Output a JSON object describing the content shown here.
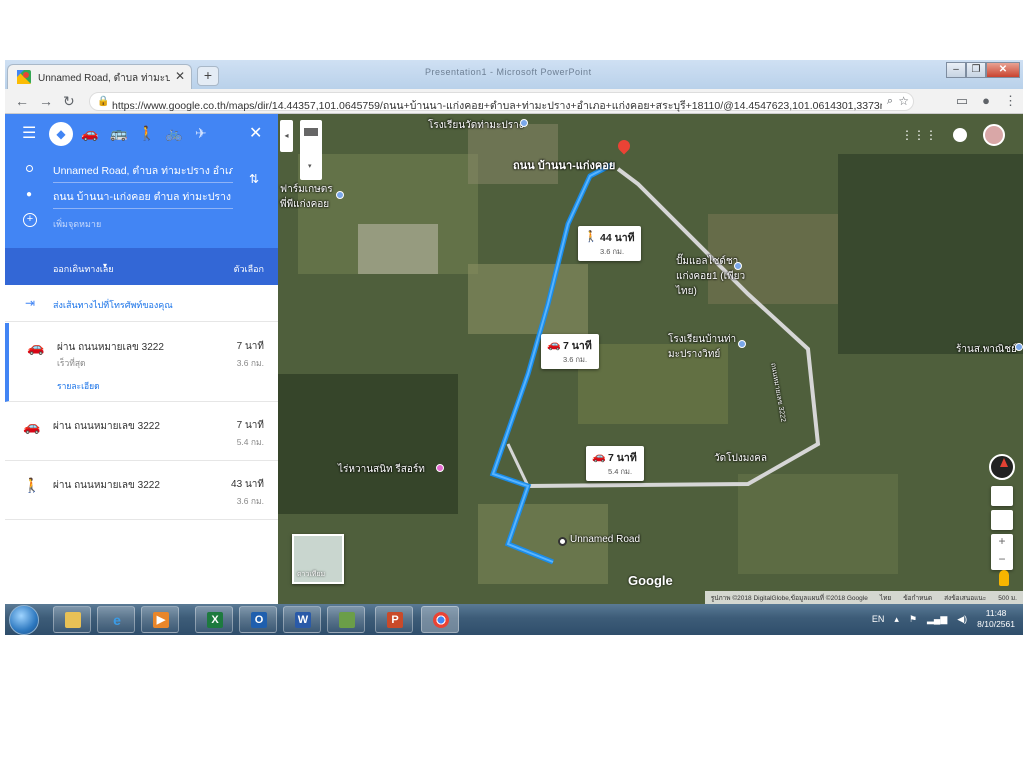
{
  "browser": {
    "tab_title": "Unnamed Road, ตำบล ท่ามะปราง อำ",
    "tab_close": "✕",
    "new_tab": "+",
    "window_title": "Presentation1 - Microsoft PowerPoint",
    "url": "https://www.google.co.th/maps/dir/14.44357,101.0645759/ถนน+บ้านนา-แก่งคอย+ตำบล+ท่ามะปราง+อำเภอ+แก่งคอย+สระบุรี+18110/@14.4547623,101.0614301,3373m/da..."
  },
  "directions": {
    "origin": "Unnamed Road, ตำบล ท่ามะปราง อำเภอ",
    "destination": "ถนน บ้านนา-แก่งคอย ตำบล ท่ามะปราง อำ",
    "add_destination": "เพิ่มจุดหมาย",
    "depart_label": "ออกเดินทางเลย",
    "options_label": "ตัวเลือก",
    "send_to_phone": "ส่งเส้นทางไปที่โทรศัพท์ของคุณ",
    "routes": [
      {
        "mode": "car",
        "via": "ผ่าน ถนนหมายเลข 3222",
        "time": "7 นาที",
        "distance": "3.6 กม.",
        "sub": "เร็วที่สุด",
        "details": "รายละเอียด"
      },
      {
        "mode": "car",
        "via": "ผ่าน ถนนหมายเลข 3222",
        "time": "7 นาที",
        "distance": "5.4 กม."
      },
      {
        "mode": "walk",
        "via": "ผ่าน ถนนหมายเลข 3222",
        "time": "43 นาที",
        "distance": "3.6 กม."
      }
    ]
  },
  "map": {
    "labels": {
      "destination_road": "ถนน บ้านนา-แก่งคอย",
      "school_top": "โรงเรียนวัดท่ามะปราง",
      "farm": "ฟาร์มเกษตรพี่พีแก่งคอย",
      "gas_station": "ปั๊มแอลไซด์ชาแก่งคอย1 (เพียวไทย)",
      "school_mid": "โรงเรียนบ้านท่ามะปรางวิทย์",
      "temple": "วัดโปงมงคล",
      "shop": "ร้านส.พาณิชย์",
      "resort": "ไร่หวานสนิท รีสอร์ท",
      "unnamed_road": "Unnamed Road",
      "road_vertical": "ถนนหมายเลข 3222"
    },
    "callouts": [
      {
        "mode": "walk",
        "time": "44 นาที",
        "distance": "3.6 กม."
      },
      {
        "mode": "car",
        "time": "7 นาที",
        "distance": "3.6 กม."
      },
      {
        "mode": "car",
        "time": "7 นาที",
        "distance": "5.4 กม."
      }
    ],
    "satellite_label": "ดาวเทียม",
    "google_logo": "Google",
    "footer": [
      "รูปภาพ ©2018 DigitalGlobe,ข้อมูลแผนที่ ©2018 Google",
      "ไทย",
      "ข้อกำหนด",
      "ส่งข้อเสนอแนะ",
      "500 ม."
    ]
  },
  "taskbar": {
    "language": "EN",
    "time": "11:48",
    "date": "8/10/2561"
  }
}
